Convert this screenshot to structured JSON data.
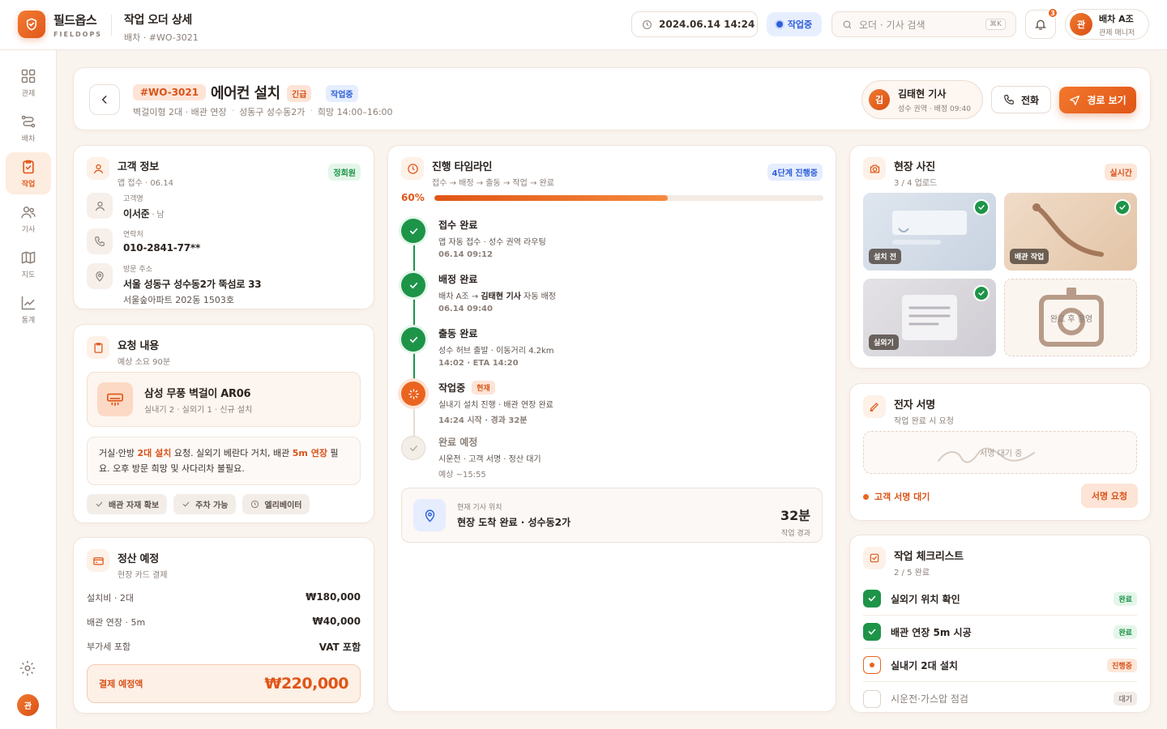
{
  "brand": {
    "name": "필드옵스",
    "sub": "FIELDOPS"
  },
  "page": {
    "title": "작업 오더 상세",
    "breadcrumb": "배차 · #WO-3021"
  },
  "topbar": {
    "datetime": "2024.06.14 14:24",
    "status": "작업중",
    "search_placeholder": "오더 · 기사 검색",
    "shortcut": "⌘K",
    "notif_count": "3",
    "user_initial": "관",
    "user_name": "배차 A조",
    "user_role": "관제 매니저"
  },
  "sidebar": {
    "items": [
      {
        "label": "관제",
        "icon": "grid-icon"
      },
      {
        "label": "배차",
        "icon": "route-icon"
      },
      {
        "label": "작업",
        "icon": "clipboard-icon"
      },
      {
        "label": "기사",
        "icon": "users-icon"
      },
      {
        "label": "지도",
        "icon": "map-icon"
      },
      {
        "label": "통계",
        "icon": "chart-icon"
      }
    ],
    "active": "작업",
    "avatar": "관"
  },
  "job": {
    "id": "#WO-3021",
    "title": "에어컨 설치",
    "urgency": "긴급",
    "status": "작업중",
    "meta": [
      "벽걸이형 2대 · 배관 연장",
      "성동구 성수동2가",
      "희망 14:00–16:00"
    ],
    "tech_initial": "김",
    "tech_name": "김태현 기사",
    "tech_sub": "성수 권역 · 배정 09:40",
    "call_label": "전화",
    "route_label": "경로 보기"
  },
  "customer": {
    "title": "고객 정보",
    "sub": "앱 접수 · 06.14",
    "badge": "정회원",
    "name_label": "고객명",
    "name": "이서준",
    "gender": " · 남",
    "phone_label": "연락처",
    "phone": "010-2841-77**",
    "addr_label": "방문 주소",
    "addr": "서울 성동구 성수동2가 뚝섬로 33",
    "addr2": "서울숲아파트 202동 1503호"
  },
  "request": {
    "title": "요청 내용",
    "sub": "예상 소요 90분",
    "product": "삼성 무풍 벽걸이 AR06",
    "product_sub": "실내기 2 · 실외기 1 · 신규 설치",
    "note_a": "거실·안방 ",
    "note_b": "2대 설치",
    "note_c": " 요청. 실외기 베란다 거치, 배관 ",
    "note_d": "5m 연장",
    "note_e": " 필요. 오후 방문 희망 및 사다리차 불필요.",
    "chips": [
      "배관 자재 확보",
      "주차 가능",
      "엘리베이터"
    ]
  },
  "payment": {
    "title": "정산 예정",
    "sub": "현장 카드 결제",
    "rows": [
      {
        "label": "설치비 · 2대",
        "value": "₩180,000"
      },
      {
        "label": "배관 연장 · 5m",
        "value": "₩40,000"
      },
      {
        "label": "부가세 포함",
        "value": "VAT 포함"
      }
    ],
    "total_label": "결제 예정액",
    "total": "₩220,000"
  },
  "timeline": {
    "title": "진행 타임라인",
    "sub": "접수 → 배정 → 출동 → 작업 → 완료",
    "badge": "4단계 진행중",
    "progress_label": "60%",
    "progress": 0.6,
    "steps": [
      {
        "title": "접수 완료",
        "desc": "앱 자동 접수 · 성수 권역 라우팅",
        "time": "06.14 09:12",
        "state": "done"
      },
      {
        "title": "배정 완료",
        "desc_a": "배차 A조 → ",
        "desc_b": "김태현 기사",
        "desc_c": " 자동 배정",
        "time": "06.14 09:40",
        "state": "done"
      },
      {
        "title": "출동 완료",
        "desc": "성수 허브 출발 · 이동거리 4.2km",
        "time": "14:02 · ETA 14:20",
        "state": "done"
      },
      {
        "title": "작업중",
        "tag": "현재",
        "desc": "실내기 설치 진행 · 배관 연장 완료",
        "time": "14:24 시작 · 경과 32분",
        "state": "current"
      },
      {
        "title": "완료 예정",
        "desc": "시운전 · 고객 서명 · 정산 대기",
        "time": "예상 ~15:55",
        "state": "todo"
      }
    ],
    "loc_label": "현재 기사 위치",
    "loc_value": "현장 도착 완료 · 성수동2가",
    "elapsed": "32분",
    "elapsed_label": "작업 경과"
  },
  "photos": {
    "title": "현장 사진",
    "sub": "3 / 4 업로드",
    "badge": "실시간",
    "items": [
      {
        "label": "설치 전"
      },
      {
        "label": "배관 작업"
      },
      {
        "label": "실외기"
      }
    ],
    "pending": "완료 후 촬영"
  },
  "signature": {
    "title": "전자 서명",
    "sub": "작업 완료 시 요청",
    "placeholder": "서명 대기 중",
    "status": "고객 서명 대기",
    "button": "서명 요청"
  },
  "checklist": {
    "title": "작업 체크리스트",
    "sub": "2 / 5 완료",
    "items": [
      {
        "label": "실외기 위치 확인",
        "status": "완료",
        "state": "done"
      },
      {
        "label": "배관 연장 5m 시공",
        "status": "완료",
        "state": "done"
      },
      {
        "label": "실내기 2대 설치",
        "status": "진행중",
        "state": "prog"
      },
      {
        "label": "시운전·가스압 점검",
        "status": "대기",
        "state": "wait"
      }
    ]
  },
  "colors": {
    "accent": "#e05516",
    "success": "#1d9448",
    "info": "#2f5fd8",
    "bg": "#faf4ef"
  }
}
